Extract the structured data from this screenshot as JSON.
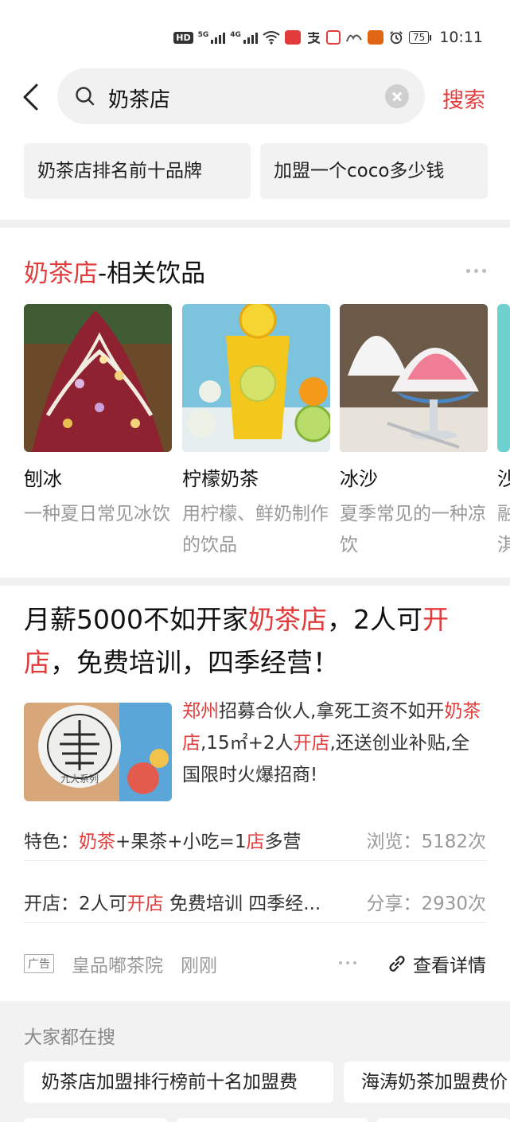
{
  "status_bar": {
    "hd": "HD",
    "net1": "5G",
    "net2": "4G",
    "battery": "75",
    "time": "10:11"
  },
  "header": {
    "query": "奶茶店",
    "search_label": "搜索"
  },
  "suggestions": [
    "奶茶店排名前十品牌",
    "加盟一个coco多少钱"
  ],
  "related": {
    "title_highlight": "奶茶店",
    "title_rest": "-相关饮品",
    "items": [
      {
        "name": "刨冰",
        "desc": "一种夏日常见冰饮"
      },
      {
        "name": "柠檬奶茶",
        "desc": "用柠檬、鲜奶制作的饮品"
      },
      {
        "name": "冰沙",
        "desc": "夏季常见的一种凉饮"
      },
      {
        "name": "沙",
        "desc": "融淇"
      }
    ]
  },
  "ad": {
    "title_parts": [
      "月薪5000不如开家",
      "奶茶店",
      "，2人可",
      "开",
      "店",
      "，免费培训，四季经营！"
    ],
    "image_text": "九大系列",
    "desc_parts": [
      "郑州",
      "招募合伙人,拿死工资不如开",
      "奶茶店",
      ",15㎡+2人",
      "开店",
      ",还送创业补贴,全国限时火爆招商!"
    ],
    "row1_parts": [
      "特色：",
      "奶茶",
      "+果茶+小吃=1",
      "店",
      "多营"
    ],
    "row1_stat": "浏览：5182次",
    "row2_parts": [
      "开店：2人可",
      "开店",
      " 免费培训 四季经..."
    ],
    "row2_stat": "分享：2930次",
    "badge": "广告",
    "source": "皇品嘟茶院",
    "time": "刚刚",
    "detail_label": "查看详情"
  },
  "people_search": {
    "title": "大家都在搜",
    "chips": [
      "奶茶店加盟排行榜前十名加盟费",
      "海涛奶茶加盟费价"
    ]
  },
  "colors": {
    "accent": "#e23b3b",
    "bg_gray": "#f2f2f2"
  }
}
